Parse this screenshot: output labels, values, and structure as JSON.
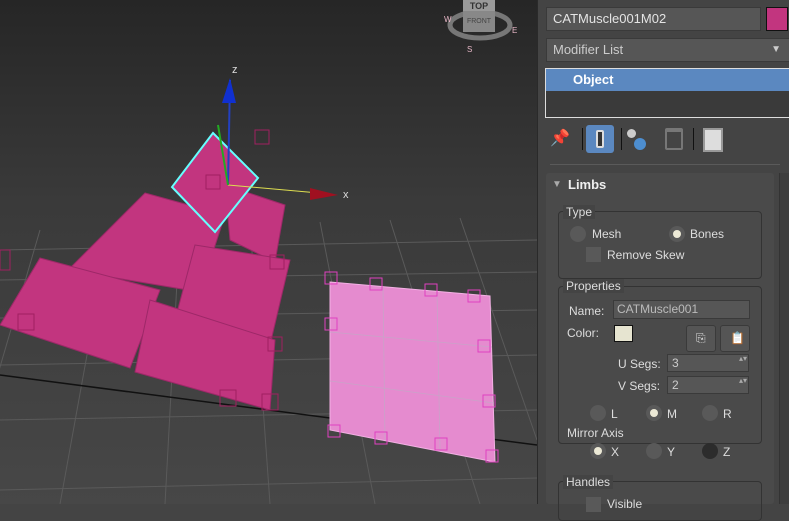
{
  "viewport": {
    "axis_x": "x",
    "axis_z": "z",
    "viewcube": {
      "top": "TOP",
      "front": "FRONT",
      "west": "W",
      "east": "E",
      "south": "S"
    }
  },
  "panel": {
    "object_name": "CATMuscle001M02",
    "object_color": "#c2357f",
    "modifier_list": "Modifier List",
    "stack": [
      "Object"
    ],
    "rollout_title": "Limbs",
    "type": {
      "label": "Type",
      "mesh": "Mesh",
      "bones": "Bones",
      "remove_skew": "Remove Skew",
      "selected": "Bones"
    },
    "properties": {
      "label": "Properties",
      "name_label": "Name:",
      "name_value": "CATMuscle001",
      "color_label": "Color:",
      "color": "#e6e4d0",
      "u_segs_label": "U Segs:",
      "u_segs": "3",
      "v_segs_label": "V Segs:",
      "v_segs": "2",
      "side": {
        "l": "L",
        "m": "M",
        "r": "R",
        "selected": "M"
      },
      "mirror_label": "Mirror Axis",
      "mirror": {
        "x": "X",
        "y": "Y",
        "z": "Z",
        "selected": "X"
      }
    },
    "handles": {
      "label": "Handles",
      "visible": "Visible"
    }
  }
}
